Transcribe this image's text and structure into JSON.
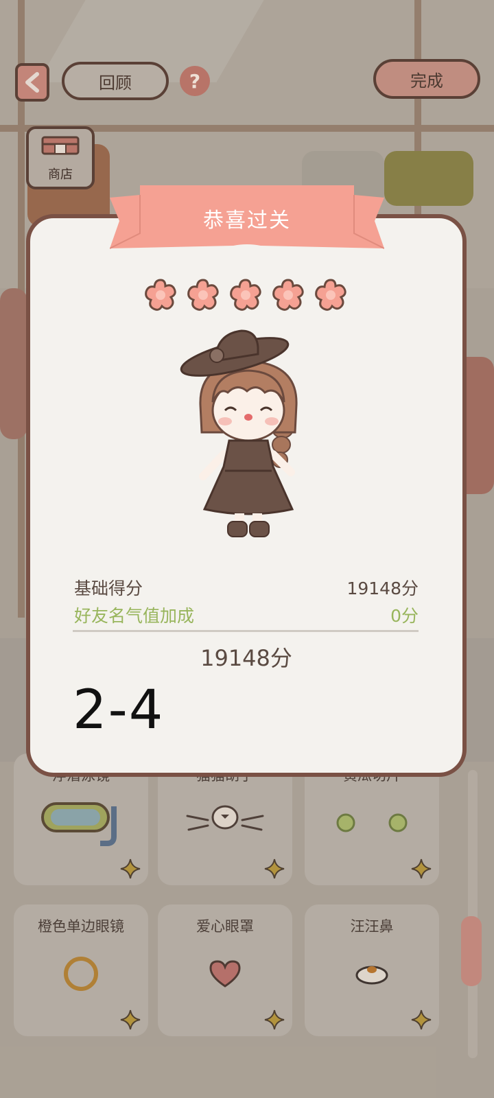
{
  "top_bar": {
    "review_label": "回顾",
    "help_label": "?",
    "done_label": "完成",
    "shop_label": "商店"
  },
  "modal": {
    "title": "恭喜过关",
    "stars_earned": 5,
    "stars_total": 5,
    "base_score_label": "基础得分",
    "base_score_value": "19148分",
    "friend_bonus_label": "好友名气值加成",
    "friend_bonus_value": "0分",
    "total_score": "19148分",
    "level": "2-4"
  },
  "items": [
    {
      "name": "浮潜泳镜",
      "icon": "snorkel-goggles-icon"
    },
    {
      "name": "猫猫胡子",
      "icon": "cat-whiskers-icon"
    },
    {
      "name": "黄瓜切片",
      "icon": "cucumber-slices-icon"
    },
    {
      "name": "橙色单边眼镜",
      "icon": "monocle-icon"
    },
    {
      "name": "爱心眼罩",
      "icon": "heart-eyepatch-icon"
    },
    {
      "name": "汪汪鼻",
      "icon": "dog-nose-icon"
    }
  ],
  "colors": {
    "accent": "#f5a193",
    "frame": "#7a5145",
    "bonus_green": "#98b55c",
    "modal_bg": "#f4f2ee"
  }
}
